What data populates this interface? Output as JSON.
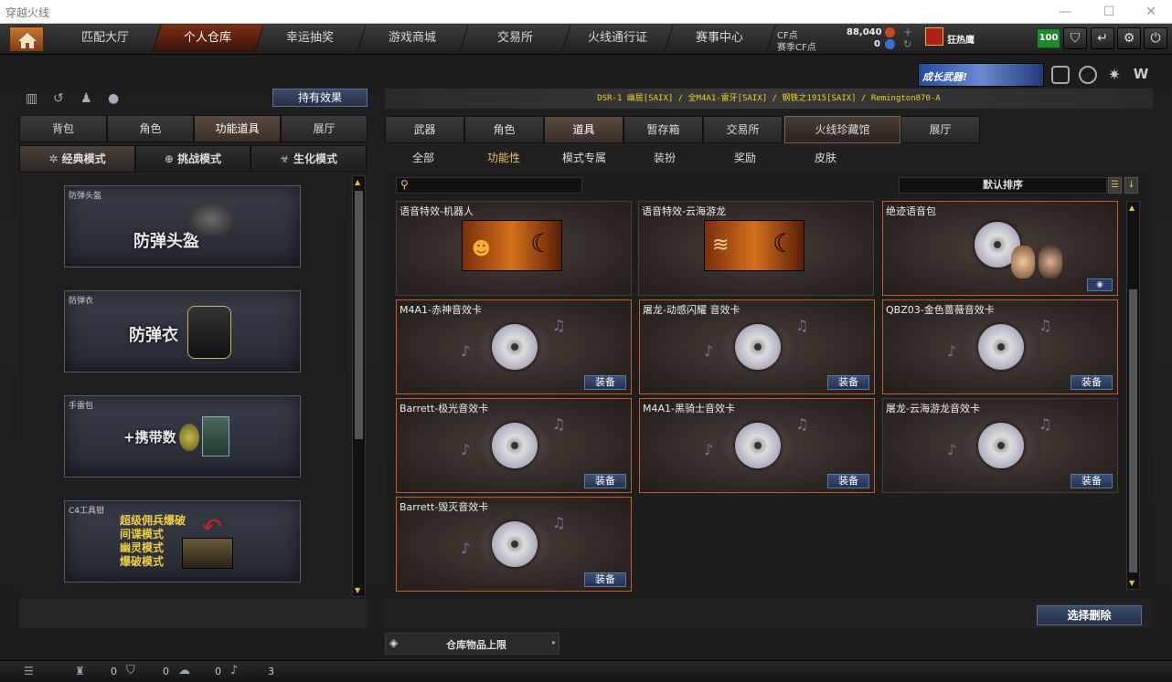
{
  "window": {
    "title": "穿越火线",
    "minimize": "—",
    "maximize": "☐",
    "close": "✕"
  },
  "topnav": {
    "tabs": [
      "匹配大厅",
      "个人仓库",
      "幸运抽奖",
      "游戏商城",
      "交易所",
      "火线通行证",
      "赛事中心"
    ],
    "active_tab": 1
  },
  "currency": {
    "cf_label": "CF点",
    "cf_value": "88,040",
    "season_cf_label": "赛季CF点",
    "season_cf_value": "0"
  },
  "user": {
    "name": "狂热鹰",
    "level": "100"
  },
  "promo": {
    "text": "成长武器!"
  },
  "left": {
    "effects_button": "持有效果",
    "tabs": [
      "背包",
      "角色",
      "功能道具",
      "展厅"
    ],
    "active_tab": 2,
    "mode_tabs": [
      "经典模式",
      "挑战模式",
      "生化模式"
    ],
    "active_mode": 0,
    "cards": [
      {
        "label": "防弹头盔",
        "big": "防弹头盔"
      },
      {
        "label": "防弹衣",
        "big": "防弹衣"
      },
      {
        "label": "手雷包",
        "big": "+携带数"
      },
      {
        "label": "C4工具钳",
        "lines": [
          "超级佣兵爆破",
          "间谍模式",
          "幽灵模式",
          "爆破模式"
        ]
      }
    ]
  },
  "right": {
    "ticker": "DSR-1 幽居[SAIX] / 全M4A1-雷牙[SAIX] / 钢铁之1915[SAIX] / Remington870-A",
    "tabs": [
      "武器",
      "角色",
      "道具",
      "暂存箱",
      "交易所",
      "火线珍藏馆",
      "展厅"
    ],
    "active_tab": 2,
    "subtabs": [
      "全部",
      "功能性",
      "模式专属",
      "装扮",
      "奖励",
      "皮肤"
    ],
    "active_subtab": 1,
    "search_placeholder": "",
    "sort_label": "默认排序",
    "items": [
      {
        "name": "语音特效-机器人",
        "kind": "banner",
        "equip": ""
      },
      {
        "name": "语音特效-云海游龙",
        "kind": "banner",
        "equip": ""
      },
      {
        "name": "绝迹语音包",
        "kind": "pack",
        "equip": ""
      },
      {
        "name": "M4A1-赤神音效卡",
        "kind": "disc",
        "equip": "装备"
      },
      {
        "name": "屠龙-动感闪耀 音效卡",
        "kind": "disc",
        "equip": "装备"
      },
      {
        "name": "QBZ03-金色蔷薇音效卡",
        "kind": "disc",
        "equip": "装备"
      },
      {
        "name": "Barrett-极光音效卡",
        "kind": "disc",
        "equip": "装备"
      },
      {
        "name": "M4A1-黑骑士音效卡",
        "kind": "disc",
        "equip": "装备"
      },
      {
        "name": "屠龙-云海游龙音效卡",
        "kind": "disc",
        "equip": "装备"
      },
      {
        "name": "Barrett-毁灭音效卡",
        "kind": "disc",
        "equip": "装备"
      }
    ],
    "delete_button": "选择删除",
    "capacity_label": "仓库物品上限"
  },
  "statusbar": {
    "friends": "0",
    "shield": "0",
    "chat": "0",
    "volume": "3"
  }
}
